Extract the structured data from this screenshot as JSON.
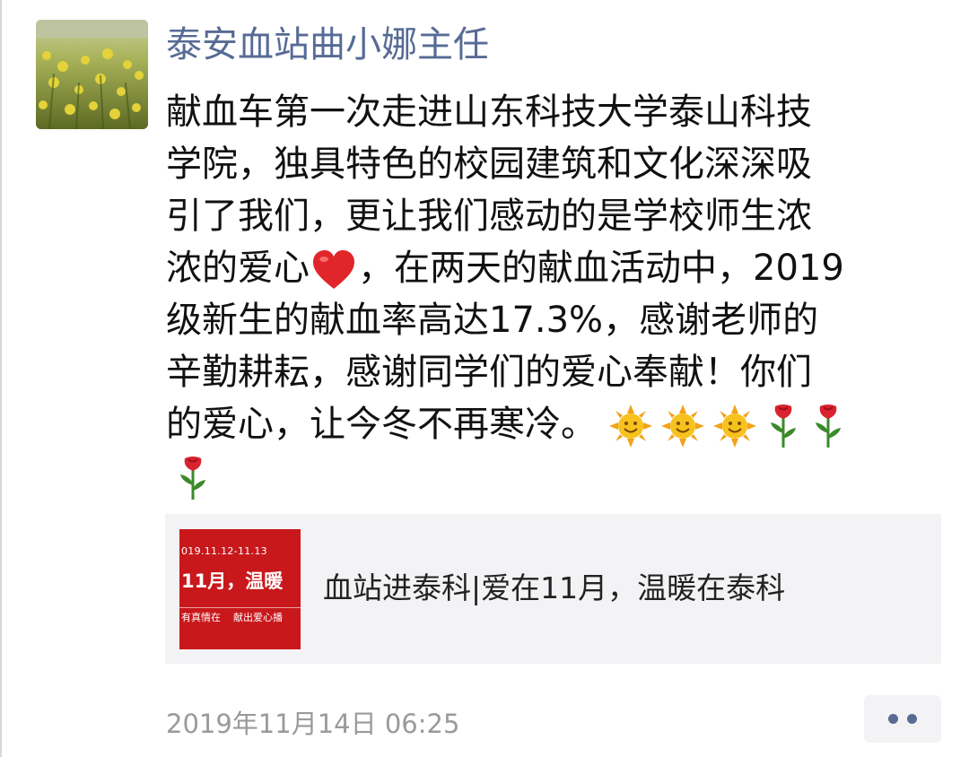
{
  "post": {
    "author": "泰安血站曲小娜主任",
    "content_lines": [
      "献血车第一次走进山东科技大学泰山科技",
      "学院，独具特色的校园建筑和文化深深吸",
      "引了我们，更让我们感动的是学校师生浓",
      "浓的爱心",
      "，在两天的献血活动中，2019",
      "级新生的献血率高达17.3%，感谢老师的",
      "辛勤耕耘，感谢同学们的爱心奉献！你们",
      "的爱心，让今冬不再寒冷。"
    ],
    "emojis": {
      "heart": "red-heart-icon",
      "sun": "smiling-sun-icon",
      "rose": "rose-icon"
    },
    "link": {
      "title": "血站进泰科|爱在11月，温暖在泰科",
      "thumbnail": {
        "date": "019.11.12-11.13",
        "headline": "11月，温暖",
        "subtitle_left": "有真情在",
        "subtitle_right": "献出爱心播"
      }
    },
    "timestamp": "2019年11月14日 06:25"
  },
  "colors": {
    "author": "#576b95",
    "text": "#111111",
    "card_bg": "#f3f3f5",
    "thumb_bg": "#c8181c",
    "timestamp": "#9a9a9a"
  }
}
